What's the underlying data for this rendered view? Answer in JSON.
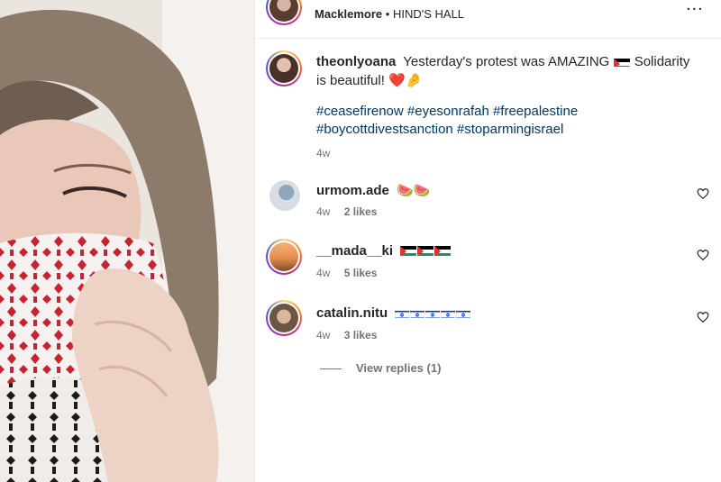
{
  "post": {
    "author": "Macklemore",
    "separator": "•",
    "audio": "HIND'S HALL",
    "more_label": "..."
  },
  "caption": {
    "user": "theonlyoana",
    "text": "Yesterday's protest was AMAZING",
    "text2": "Solidarity is beautiful!",
    "emoji_heart": "❤️",
    "emoji_hand": "🤌",
    "flag_icon": "palestine-flag-icon",
    "hashtags_line1": "#ceasefirenow #eyesonrafah #freepalestine",
    "hashtags_line2": "#boycottdivestsanction #stoparmingisrael",
    "time": "4w"
  },
  "comments": [
    {
      "user": "urmom.ade",
      "content": "🍉🍉",
      "time": "4w",
      "likes": "2 likes"
    },
    {
      "user": "__mada__ki",
      "content": "",
      "flags": "palestine-flag-icon x3",
      "time": "4w",
      "likes": "5 likes"
    },
    {
      "user": "catalin.nitu",
      "content": "",
      "flags": "israel-flag-icon x5",
      "time": "4w",
      "likes": "3 likes"
    }
  ],
  "view_replies": "View replies (1)",
  "colors": {
    "hashtag": "#00376b",
    "muted": "#737373",
    "text": "#262626"
  }
}
